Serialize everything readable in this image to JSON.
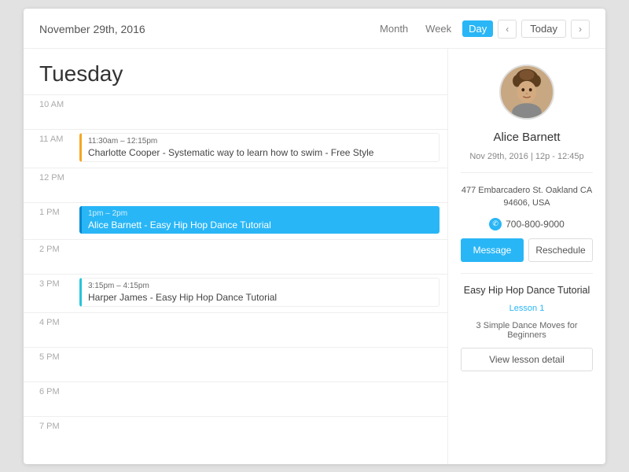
{
  "header": {
    "date": "November 29th, 2016",
    "views": [
      "Month",
      "Week",
      "Day"
    ],
    "active_view": "Day",
    "nav_prev": "‹",
    "nav_next": "›",
    "today_label": "Today"
  },
  "calendar": {
    "day_title": "Tuesday",
    "time_slots": [
      {
        "time": "10 AM",
        "events": []
      },
      {
        "time": "11 AM",
        "events": [
          {
            "type": "orange",
            "time_range": "11:30am – 12:15pm",
            "title": "Charlotte Cooper - Systematic way to learn how to swim - Free Style"
          }
        ]
      },
      {
        "time": "12 PM",
        "events": []
      },
      {
        "time": "1 PM",
        "events": [
          {
            "type": "blue",
            "time_range": "1pm – 2pm",
            "title": "Alice Barnett - Easy Hip Hop Dance Tutorial"
          }
        ]
      },
      {
        "time": "2 PM",
        "events": []
      },
      {
        "time": "3 PM",
        "events": [
          {
            "type": "teal",
            "time_range": "3:15pm – 4:15pm",
            "title": "Harper James - Easy Hip Hop Dance Tutorial"
          }
        ]
      },
      {
        "time": "4 PM",
        "events": []
      },
      {
        "time": "5 PM",
        "events": []
      },
      {
        "time": "6 PM",
        "events": []
      },
      {
        "time": "7 PM",
        "events": []
      }
    ]
  },
  "sidebar": {
    "user_name": "Alice Barnett",
    "appointment_date": "Nov 29th, 2016  |  12p - 12:45p",
    "address_line1": "477 Embarcadero St. Oakland CA",
    "address_line2": "94606, USA",
    "phone": "700-800-9000",
    "btn_message": "Message",
    "btn_reschedule": "Reschedule",
    "lesson_title": "Easy Hip Hop Dance Tutorial",
    "lesson_number": "Lesson 1",
    "lesson_desc": "3 Simple Dance Moves for Beginners",
    "btn_view_lesson": "View lesson detail"
  }
}
